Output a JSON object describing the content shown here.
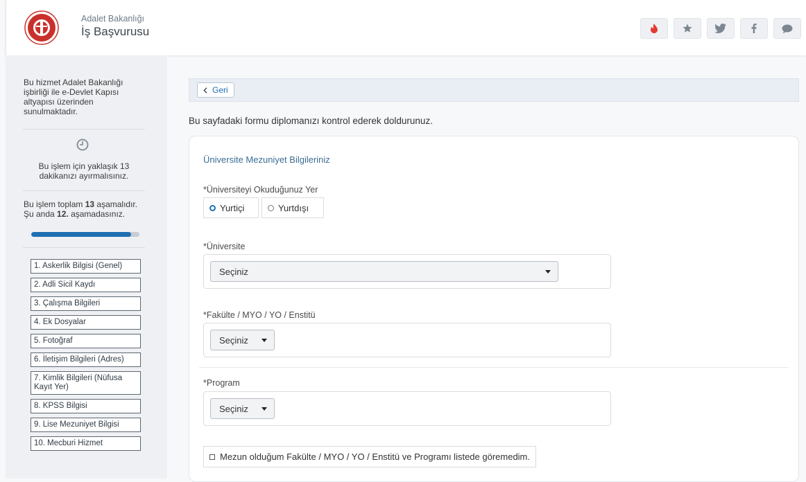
{
  "header": {
    "org_name": "Adalet Bakanlığı",
    "service_name": "İş Başvurusu",
    "buttons": [
      {
        "icon": "fire-icon"
      },
      {
        "icon": "star-icon"
      },
      {
        "icon": "twitter-icon"
      },
      {
        "icon": "facebook-icon"
      },
      {
        "icon": "comment-icon"
      }
    ],
    "colors": {
      "fire": "#e23a2e",
      "icon": "#7c8691"
    }
  },
  "sidebar": {
    "intro": "Bu hizmet Adalet Bakanlığı işbirliği ile e-Devlet Kapısı altyapısı üzerinden sunulmaktadır.",
    "time_note": "Bu işlem için yaklaşık 13 dakikanızı ayırmalısınız.",
    "steps_prefix": "Bu işlem toplam ",
    "steps_total": "13",
    "steps_mid": " aşamalıdır. Şu anda ",
    "steps_current": "12.",
    "steps_suffix": " aşamadasınız.",
    "progress_fraction": 0.92,
    "progress_color": "#1f6fb2",
    "items": [
      {
        "label": "1. Askerlik Bilgisi (Genel)"
      },
      {
        "label": "2. Adli Sicil Kaydı"
      },
      {
        "label": "3. Çalışma Bilgileri"
      },
      {
        "label": "4. Ek Dosyalar"
      },
      {
        "label": "5. Fotoğraf"
      },
      {
        "label": "6. İletişim Bilgileri (Adres)"
      },
      {
        "label": "7. Kimlik Bilgileri (Nüfusa Kayıt Yer)"
      },
      {
        "label": "8. KPSS Bilgisi"
      },
      {
        "label": "9. Lise Mezuniyet Bilgisi"
      },
      {
        "label": "10. Mecburi Hizmet"
      }
    ]
  },
  "main": {
    "back_label": "Geri",
    "instruction": "Bu sayfadaki formu diplomanızı kontrol ederek doldurunuz.",
    "card_title": "Üniversite Mezuniyet Bilgileriniz",
    "location_label": "*Üniversiteyi Okuduğunuz Yer",
    "location_options": [
      "Yurtiçi",
      "Yurtdışı"
    ],
    "location_selected": "Yurtiçi",
    "university_label": "*Üniversite",
    "university_value": "Seçiniz",
    "faculty_label": "*Fakülte / MYO / YO / Enstitü",
    "faculty_value": "Seçiniz",
    "program_label": "*Program",
    "program_value": "Seçiniz",
    "not_listed_label": "Mezun olduğum Fakülte / MYO / YO / Enstitü ve Programı listede göremedim."
  }
}
